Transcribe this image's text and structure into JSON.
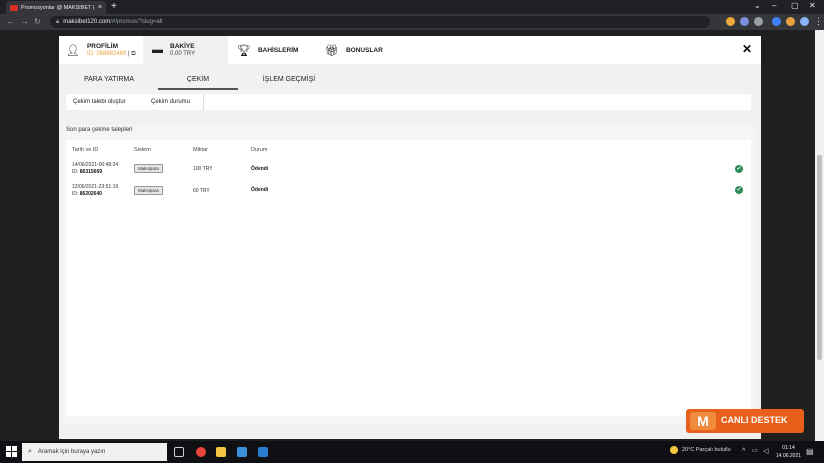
{
  "browser": {
    "tab_title": "Promosyonlar @ MAKSİBET | Spo",
    "tab_close": "×",
    "new_tab": "+",
    "url_host": "maksibet120.com",
    "url_path": "/#/promos/?slug=all",
    "back": "←",
    "forward": "→",
    "reload": "C",
    "minimize": "–",
    "maximize": "▢",
    "close": "✕"
  },
  "modal": {
    "tabs": [
      {
        "label": "PROFİLİM",
        "sub": "ID: 268883469",
        "icon": "user-icon"
      },
      {
        "label": "BAKİYE",
        "sub": "0.00 TRY",
        "icon": "wallet-icon"
      },
      {
        "label": "BAHİSLERİM",
        "icon": "trophy-icon"
      },
      {
        "label": "BONUSLAR",
        "icon": "gift-icon"
      }
    ],
    "close_label": "✕",
    "sub_tabs": [
      "PARA YATIRMA",
      "ÇEKİM",
      "İŞLEM GEÇMİŞİ"
    ],
    "actions": [
      "Çekim talebi oluştur",
      "Çekim durumu"
    ],
    "list": {
      "title": "Son para çekme talepleri",
      "headers": [
        "Tarih ve ID",
        "Sistem",
        "Miktar",
        "Durum"
      ],
      "rows": [
        {
          "date": "14/06/2021-00:48:24",
          "id_label": "ID:",
          "id": "86315669",
          "system": "Maksipara",
          "amount": "100 TRY",
          "status": "Ödendi"
        },
        {
          "date": "12/06/2021-23:51:19",
          "id_label": "ID:",
          "id": "86202640",
          "system": "Maksipara",
          "amount": "60 TRY",
          "status": "Ödendi"
        }
      ]
    }
  },
  "support": {
    "label": "CANLI DESTEK"
  },
  "taskbar": {
    "search_placeholder": "Aramak için buraya yazın",
    "weather": "20°C  Parçalı bulutlu",
    "time": "01:14",
    "date": "14.06.2021"
  },
  "colors": {
    "accent": "#e8601c",
    "id_orange": "#e8a33d",
    "success": "#2e8b57"
  }
}
